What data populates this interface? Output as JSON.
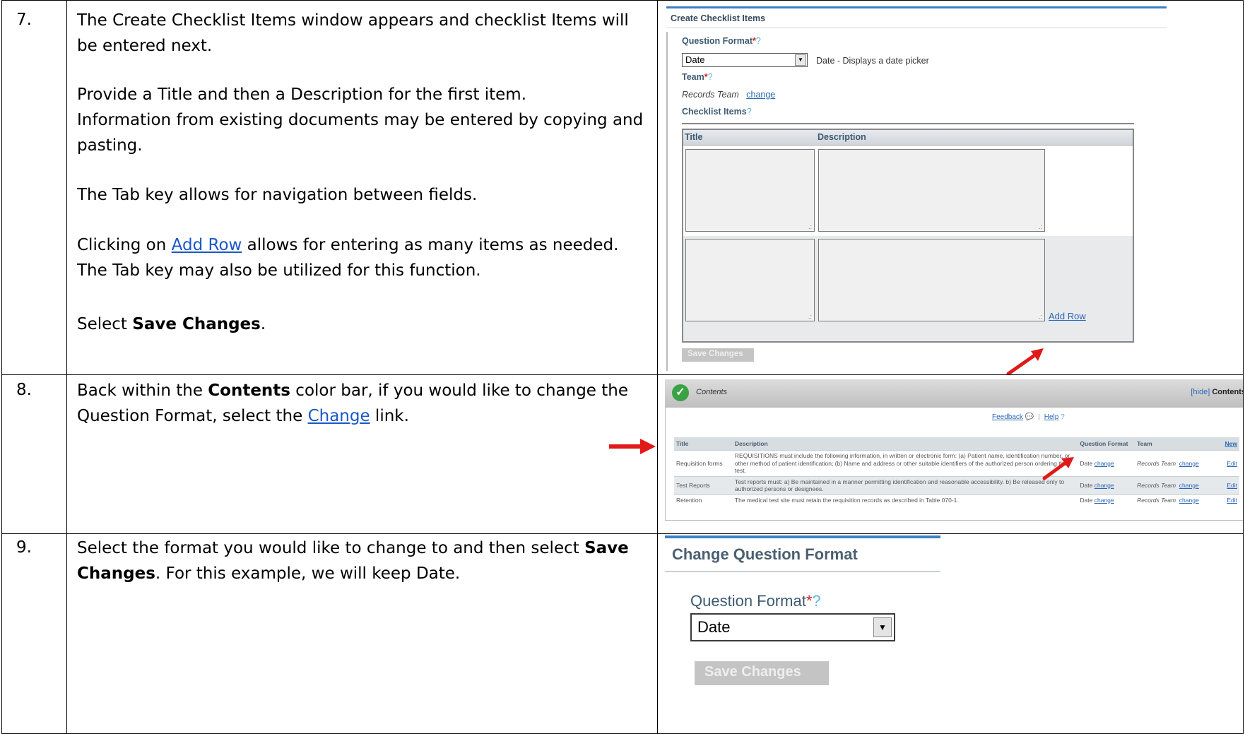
{
  "steps": [
    {
      "number": "7.",
      "paragraphs": {
        "p1": "The Create Checklist Items window appears and checklist Items will be entered next.",
        "p2a": "Provide a Title and then a Description for the first item.",
        "p2b": "Information from existing documents may be entered by copying and pasting.",
        "p3": "The Tab key allows for navigation between fields.",
        "p4_pre": "Clicking on ",
        "p4_link": "Add Row",
        "p4_post": " allows for entering as many items as needed.",
        "p4b": "The Tab key may also be utilized for this function.",
        "p5_pre": "Select ",
        "p5_bold": "Save Changes",
        "p5_post": "."
      }
    },
    {
      "number": "8.",
      "paragraphs": {
        "p1_pre": "Back within the ",
        "p1_bold": "Contents",
        "p1_mid": " color bar, if you would like to change the Question Format, select the ",
        "p1_link": "Change",
        "p1_post": " link."
      }
    },
    {
      "number": "9.",
      "paragraphs": {
        "p1_pre": "Select the format you would like to change to and then select ",
        "p1_bold": "Save Changes",
        "p1_post": ".  For this example, we will keep Date."
      }
    }
  ],
  "create_checklist": {
    "window_title": "Create Checklist Items",
    "question_format_label": "Question Format",
    "required_mark": "*",
    "help_mark": "?",
    "question_format_value": "Date",
    "question_format_hint": "Date - Displays a date picker",
    "team_label": "Team",
    "team_value": "Records Team",
    "team_change_link": "change",
    "checklist_items_label": "Checklist Items",
    "col_title": "Title",
    "col_description": "Description",
    "add_row_link": "Add Row",
    "save_button": "Save Changes"
  },
  "contents_panel": {
    "bar_title": "Contents",
    "hide_link": "[hide]",
    "bar_right_label": "Contents",
    "feedback_link": "Feedback",
    "help_link": "Help",
    "columns": [
      "Title",
      "Description",
      "Question Format",
      "Team",
      "New"
    ],
    "rows": [
      {
        "title": "Requisition forms",
        "description": "REQUISITIONS must include the following information, in written or electronic form: (a) Patient name, identification number, or other method of patient identification; (b) Name and address or other suitable identifiers of the authorized person ordering the test.",
        "format": "Date",
        "format_link": "change",
        "team": "Records Team",
        "team_link": "change",
        "edit": "Edit"
      },
      {
        "title": "Test Reports",
        "description": "Test reports must: a) Be maintained in a manner permitting identification and reasonable accessibility. b) Be released only to authorized persons or designees.",
        "format": "Date",
        "format_link": "change",
        "team": "Records Team",
        "team_link": "change",
        "edit": "Edit"
      },
      {
        "title": "Retention",
        "description": "The medical test site must retain the requisition records as described in Table 070-1.",
        "format": "Date",
        "format_link": "change",
        "team": "Records Team",
        "team_link": "change",
        "edit": "Edit"
      }
    ]
  },
  "change_format": {
    "title": "Change Question Format",
    "label": "Question Format",
    "required_mark": "*",
    "help_mark": "?",
    "value": "Date",
    "save_button": "Save Changes"
  },
  "colors": {
    "arrow": "#e11919",
    "link": "#1a58c9"
  }
}
